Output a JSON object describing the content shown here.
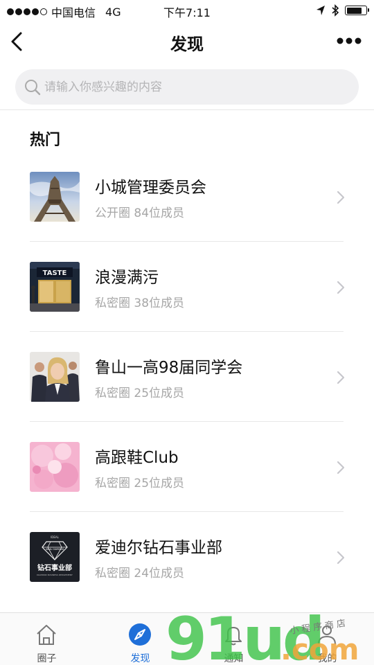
{
  "status_bar": {
    "carrier": "中国电信",
    "network": "4G",
    "time": "下午7:11"
  },
  "nav": {
    "title": "发现"
  },
  "search": {
    "placeholder": "请输入你感兴趣的内容"
  },
  "section": {
    "title": "热门"
  },
  "groups": [
    {
      "title": "小城管理委员会",
      "subtitle": "公开圈 84位成员",
      "thumb": "eiffel-tower-photo"
    },
    {
      "title": "浪漫满污",
      "subtitle": "私密圈 38位成员",
      "thumb": "storefront-photo"
    },
    {
      "title": "鲁山一高98届同学会",
      "subtitle": "私密圈 25位成员",
      "thumb": "business-people-photo"
    },
    {
      "title": "高跟鞋Club",
      "subtitle": "私密圈 25位成员",
      "thumb": "pink-dress-photo"
    },
    {
      "title": "爱迪尔钻石事业部",
      "subtitle": "私密圈 24位成员",
      "thumb": "diamond-logo"
    }
  ],
  "diamond_logo": {
    "top_text": "IDEAL",
    "ring_text": "IDEAL DIAMOND",
    "name": "钻石事业部",
    "sub_text": "DIAMOND BUSINESS DEPARTMENT"
  },
  "tabs": [
    {
      "label": "圈子",
      "icon": "home-icon",
      "active": false
    },
    {
      "label": "发现",
      "icon": "compass-icon",
      "active": true
    },
    {
      "label": "通知",
      "icon": "bell-icon",
      "active": false
    },
    {
      "label": "我的",
      "icon": "person-icon",
      "active": false
    }
  ],
  "watermark": {
    "main": "91ud",
    "suffix": ".com",
    "tagline": "小程序商店"
  },
  "colors": {
    "accent": "#1f6fd8",
    "watermark_green": "#3fc34a",
    "watermark_orange": "#f0a43a"
  }
}
